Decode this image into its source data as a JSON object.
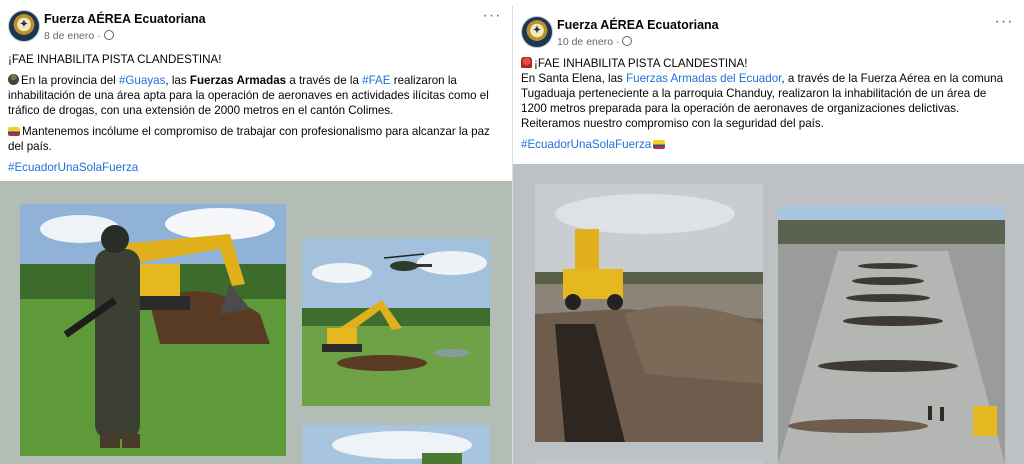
{
  "posts": [
    {
      "page_name": "Fuerza AÉREA Ecuatoriana",
      "date": "8 de enero ·",
      "headline": "¡FAE INHABILITA PISTA CLANDESTINA!",
      "p1": {
        "t1": "En la provincia del ",
        "tag1": "#Guayas",
        "t2": ", las ",
        "bold1": "Fuerzas Armadas",
        "t3": " a través de la ",
        "tag2": "#FAE",
        "t4": " realizaron la inhabilitación de una área apta para la operación de aeronaves en actividades ilícitas como el tráfico de drogas, con una extensión de 2000 metros en el cantón Colimes."
      },
      "p2": "Mantenemos incólume el compromiso de trabajar con profesionalismo para alcanzar la paz del país.",
      "hashtag": "#EcuadorUnaSolaFuerza",
      "photos": [
        "soldier-with-excavator-photo",
        "helicopter-over-excavator-photo",
        "field-photo"
      ]
    },
    {
      "page_name": "Fuerza AÉREA Ecuatoriana",
      "date": "10 de enero ·",
      "headline": "¡FAE INHABILITA PISTA CLANDESTINA!",
      "p1": {
        "t1": "En Santa Elena, las ",
        "tag1": "Fuerzas Armadas del Ecuador",
        "t2": ", a través de la Fuerza Aérea en la comuna Tugaduaja perteneciente a la parroquia Chanduy, realizaron la inhabilitación de un área de 1200 metros preparada para la operación de aeronaves de organizaciones delictivas."
      },
      "p2": "Reiteramos nuestro compromiso con la seguridad del país.",
      "hashtag": "#EcuadorUnaSolaFuerza",
      "photos": [
        "backhoe-trench-photo",
        "aerial-airstrip-photo"
      ]
    }
  ],
  "colors": {
    "link": "#216fdb",
    "muted": "#65676b",
    "media_bg_1": "#b2bdb5",
    "media_bg_2": "#bdc1c4"
  },
  "icons": {
    "more": "more-options-icon",
    "privacy": "globe-icon"
  }
}
